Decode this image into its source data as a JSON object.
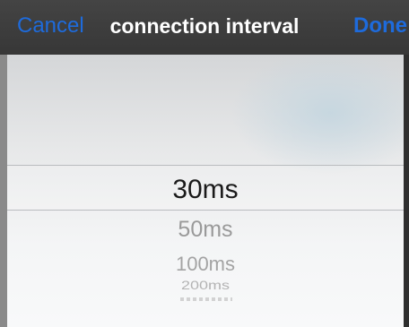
{
  "navbar": {
    "cancel_label": "Cancel",
    "title": "connection interval",
    "done_label": "Done"
  },
  "picker": {
    "selected_value": "30ms",
    "options": [
      "30ms",
      "50ms",
      "100ms",
      "200ms"
    ]
  },
  "colors": {
    "accent": "#1e6bdc",
    "navbar_bg": "#3d3d3d",
    "title_text": "#ffffff"
  }
}
